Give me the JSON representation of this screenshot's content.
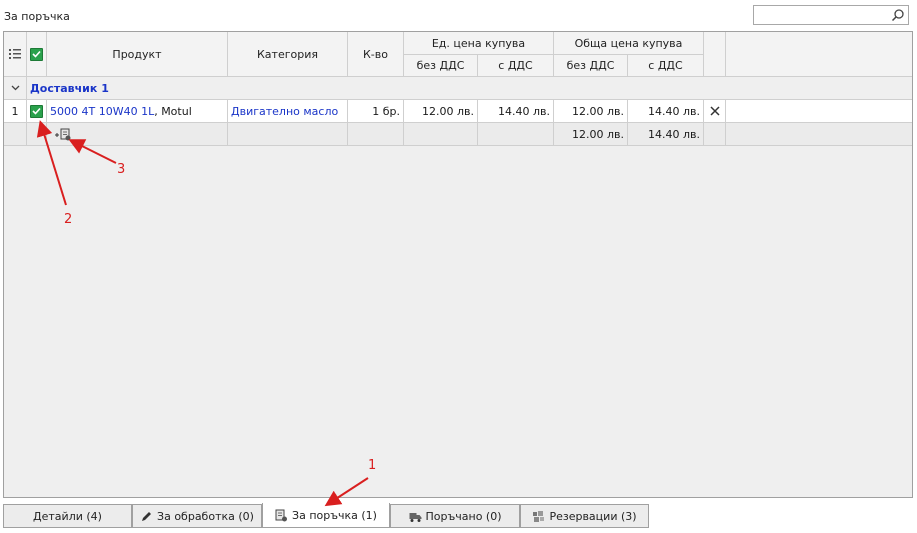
{
  "panel": {
    "title": "За поръчка"
  },
  "search": {
    "value": "",
    "placeholder": ""
  },
  "columns": {
    "product": "Продукт",
    "category": "Категория",
    "qty": "К-во",
    "unit_group": "Ед. цена купува",
    "total_group": "Обща цена купува",
    "no_vat": "без ДДС",
    "with_vat": "с ДДС"
  },
  "group": {
    "label": "Доставчик 1"
  },
  "rows": [
    {
      "num": "1",
      "product_code": "5000 4T 10W40 1L",
      "product_brand": ", Motul",
      "category": "Двигателно масло",
      "qty": "1 бр.",
      "unit_no_vat": "12.00 лв.",
      "unit_with_vat": "14.40 лв.",
      "total_no_vat": "12.00 лв.",
      "total_with_vat": "14.40 лв."
    }
  ],
  "summary": {
    "total_no_vat": "12.00 лв.",
    "total_with_vat": "14.40 лв."
  },
  "tabs": [
    {
      "label": "Детайли (4)",
      "icon": "none"
    },
    {
      "label": "За обработка (0)",
      "icon": "pencil-icon"
    },
    {
      "label": "За поръчка (1)",
      "icon": "order-icon"
    },
    {
      "label": "Поръчано (0)",
      "icon": "truck-icon"
    },
    {
      "label": "Резервации (3)",
      "icon": "reservation-icon"
    }
  ],
  "annotations": {
    "a1": "1",
    "a2": "2",
    "a3": "3"
  },
  "colors": {
    "check": "#2aa14c",
    "link": "#1a35c8",
    "annotation": "#d91f1f"
  }
}
